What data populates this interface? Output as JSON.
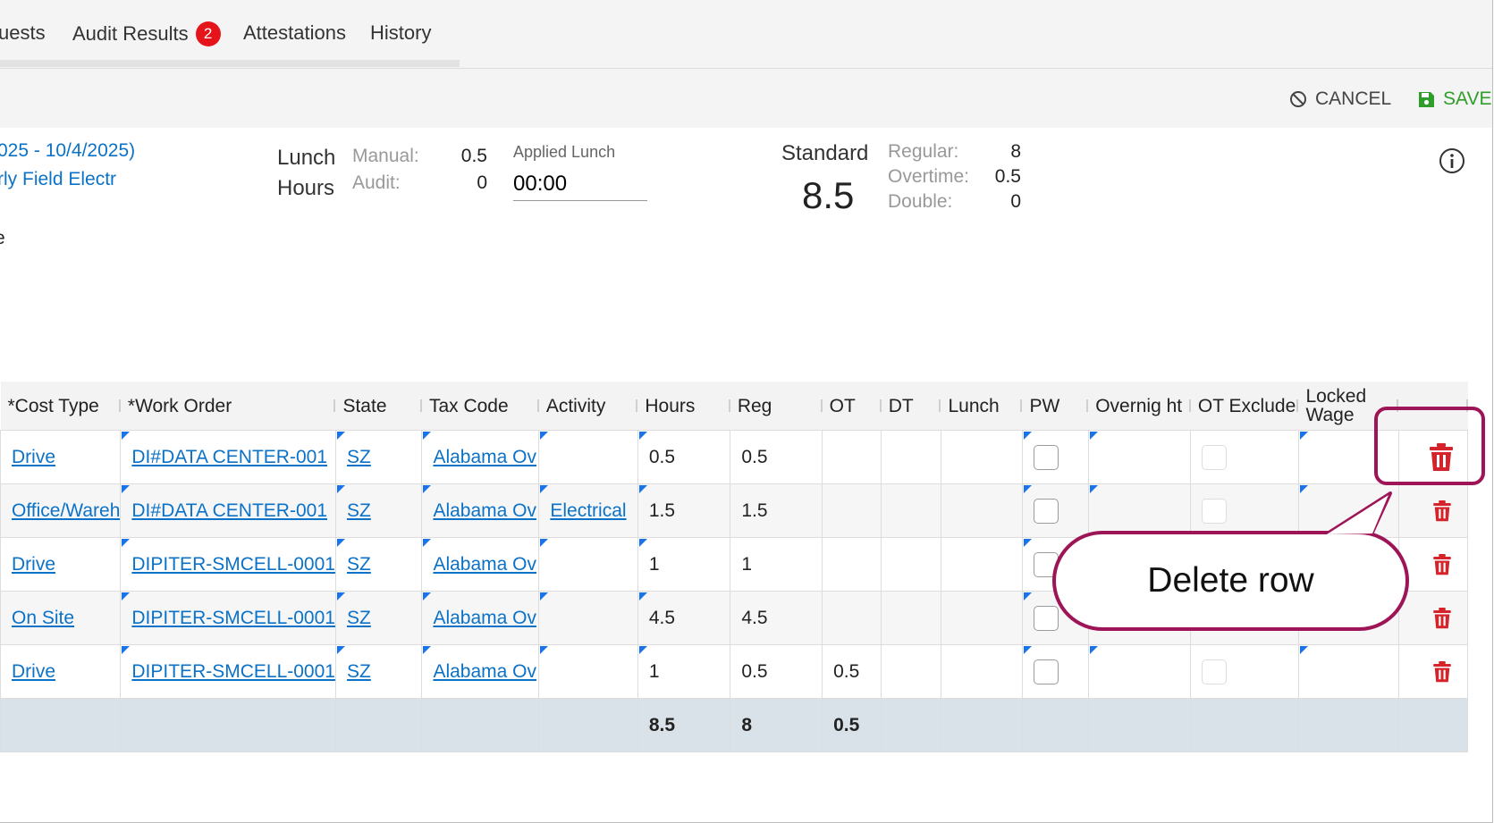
{
  "tabs": [
    {
      "label": "uests"
    },
    {
      "label": "Audit Results",
      "badge": "2"
    },
    {
      "label": "Attestations"
    },
    {
      "label": "History"
    }
  ],
  "toolbar": {
    "cancel": "CANCEL",
    "save": "SAVE"
  },
  "summary": {
    "date_range": "025 - 10/4/2025)",
    "employee_class": "rly Field Electr",
    "extra": "e",
    "lunch": {
      "title_line1": "Lunch",
      "title_line2": "Hours",
      "manual_label": "Manual:",
      "manual_value": "0.5",
      "audit_label": "Audit:",
      "audit_value": "0",
      "applied_label": "Applied Lunch",
      "applied_value": "00:00"
    },
    "standard": {
      "label": "Standard",
      "total": "8.5",
      "regular_label": "Regular:",
      "regular_value": "8",
      "overtime_label": "Overtime:",
      "overtime_value": "0.5",
      "double_label": "Double:",
      "double_value": "0"
    }
  },
  "grid": {
    "headers": [
      "*Cost Type",
      "*Work Order",
      "State",
      "Tax Code",
      "Activity",
      "Hours",
      "Reg",
      "OT",
      "DT",
      "Lunch",
      "PW",
      "Overnig ht",
      "OT Exclude",
      "Locked Wage",
      ""
    ],
    "rows": [
      {
        "cost_type": "Drive",
        "work_order": "DI#DATA CENTER-001",
        "state": "SZ",
        "tax_code": "Alabama Ov",
        "activity": "",
        "hours": "0.5",
        "reg": "0.5",
        "ot": "",
        "dt": ""
      },
      {
        "cost_type": "Office/Wareh",
        "work_order": "DI#DATA CENTER-001",
        "state": "SZ",
        "tax_code": "Alabama Ov",
        "activity": "Electrical",
        "hours": "1.5",
        "reg": "1.5",
        "ot": "",
        "dt": ""
      },
      {
        "cost_type": "Drive",
        "work_order": "DIPITER-SMCELL-0001",
        "state": "SZ",
        "tax_code": "Alabama Ov",
        "activity": "",
        "hours": "1",
        "reg": "1",
        "ot": "",
        "dt": ""
      },
      {
        "cost_type": "On Site",
        "work_order": "DIPITER-SMCELL-0001",
        "state": "SZ",
        "tax_code": "Alabama Ov",
        "activity": "",
        "hours": "4.5",
        "reg": "4.5",
        "ot": "",
        "dt": ""
      },
      {
        "cost_type": "Drive",
        "work_order": "DIPITER-SMCELL-0001",
        "state": "SZ",
        "tax_code": "Alabama Ov",
        "activity": "",
        "hours": "1",
        "reg": "0.5",
        "ot": "0.5",
        "dt": ""
      }
    ],
    "totals": {
      "hours": "8.5",
      "reg": "8",
      "ot": "0.5"
    }
  },
  "callout": {
    "text": "Delete row"
  },
  "colors": {
    "accent": "#9e1557",
    "link": "#0b72c7",
    "save": "#2e9d2a",
    "delete": "#d6222a",
    "badge": "#e5141b"
  }
}
